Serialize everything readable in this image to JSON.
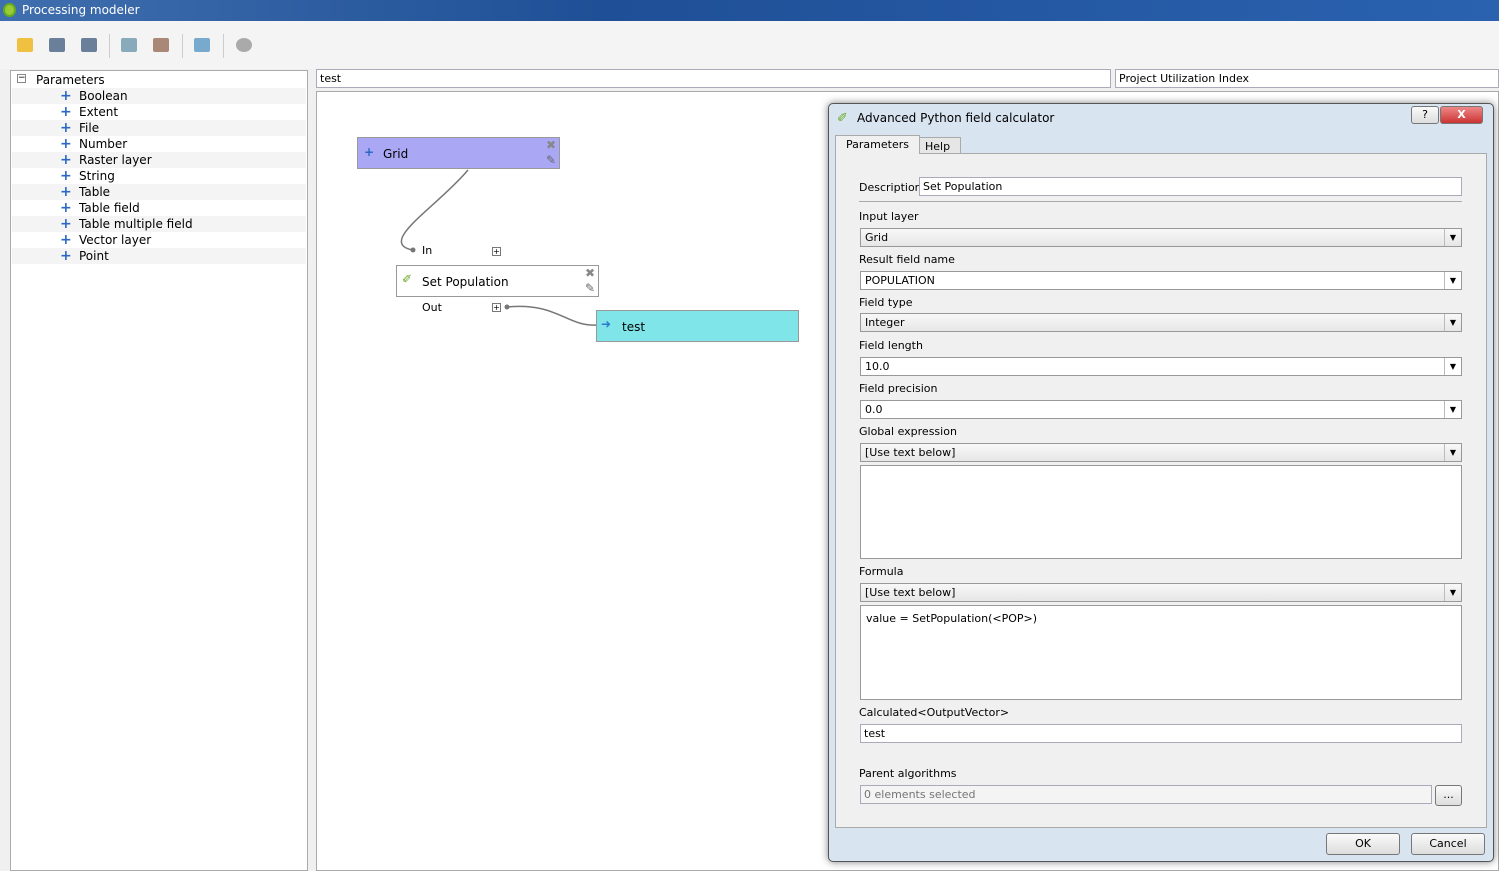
{
  "window": {
    "title": "Processing modeler"
  },
  "toolbar": {
    "icons": [
      "open-icon",
      "save-icon",
      "save-as-icon",
      "export-image-icon",
      "export-python-icon",
      "edit-help-icon",
      "run-icon"
    ]
  },
  "params": {
    "root": "Parameters",
    "items": [
      "Boolean",
      "Extent",
      "File",
      "Number",
      "Raster layer",
      "String",
      "Table",
      "Table field",
      "Table multiple field",
      "Vector layer",
      "Point"
    ]
  },
  "model": {
    "name": "test",
    "group": "Project Utilization Index"
  },
  "canvas": {
    "nodes": {
      "grid": "Grid",
      "in": "In",
      "algo": "Set Population",
      "out": "Out",
      "output": "test"
    },
    "colors": {
      "input": "#aaa8f5",
      "output": "#80e5e8"
    }
  },
  "dialog": {
    "title": "Advanced Python field calculator",
    "help": "?",
    "close": "X",
    "tabs": [
      "Parameters",
      "Help"
    ],
    "description_label": "Description",
    "description": "Set Population",
    "input_layer_label": "Input layer",
    "input_layer": "Grid",
    "result_field_label": "Result field name",
    "result_field": "POPULATION",
    "field_type_label": "Field type",
    "field_type": "Integer",
    "field_length_label": "Field length",
    "field_length": "10.0",
    "field_precision_label": "Field precision",
    "field_precision": "0.0",
    "global_label": "Global expression",
    "global": "[Use text below]",
    "global_text": "",
    "formula_label": "Formula",
    "formula": "[Use text below]",
    "formula_text": "value = SetPopulation(<POP>)",
    "calc_label": "Calculated<OutputVector>",
    "calc": "test",
    "parent_label": "Parent algorithms",
    "parent_placeholder": "0 elements selected",
    "parent_btn": "...",
    "ok": "OK",
    "cancel": "Cancel"
  }
}
